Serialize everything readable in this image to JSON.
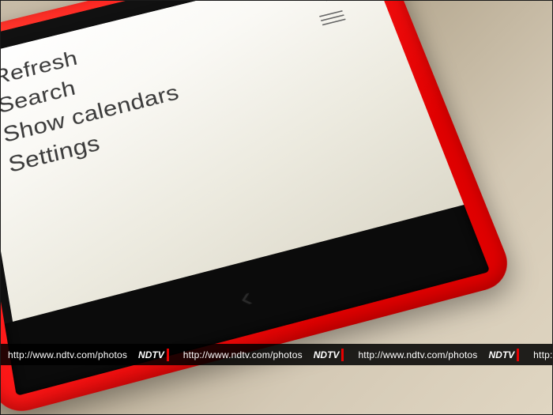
{
  "menu": {
    "items": [
      {
        "label": "Refresh"
      },
      {
        "label": "Search"
      },
      {
        "label": "Show calendars"
      },
      {
        "label": "Settings"
      }
    ],
    "add_icon": "+",
    "more_icon": "menu"
  },
  "nav": {
    "back_glyph": "‹"
  },
  "watermark": {
    "url": "http://www.ndtv.com/photos",
    "brand": "NDTV"
  }
}
